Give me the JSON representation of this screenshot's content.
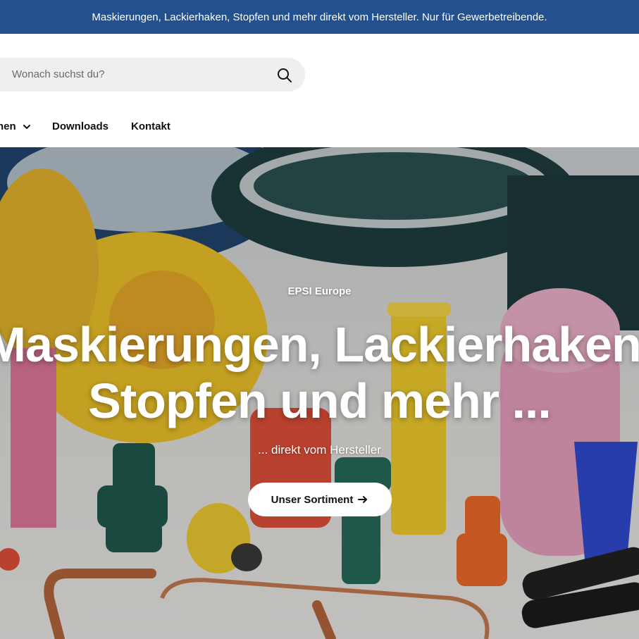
{
  "announcement": {
    "text": "Maskierungen, Lackierhaken, Stopfen und mehr direkt vom Hersteller. Nur für Gewerbetreibende."
  },
  "search": {
    "placeholder": "Wonach suchst du?",
    "icon": "search-icon"
  },
  "nav": {
    "items": [
      {
        "label": "hen",
        "icon": "chevron-down-icon"
      },
      {
        "label": "Downloads"
      },
      {
        "label": "Kontakt"
      }
    ]
  },
  "hero": {
    "eyebrow": "EPSI Europe",
    "headline_line1": "Maskierungen, Lackierhaken,",
    "headline_line2": "Stopfen und mehr ...",
    "subline": "... direkt vom Hersteller",
    "cta_label": "Unser Sortiment",
    "cta_icon": "arrow-right-icon"
  },
  "colors": {
    "announcement_bg": "#23508f",
    "text_dark": "#111111",
    "search_bg": "#efefef",
    "cta_bg": "#ffffff"
  }
}
